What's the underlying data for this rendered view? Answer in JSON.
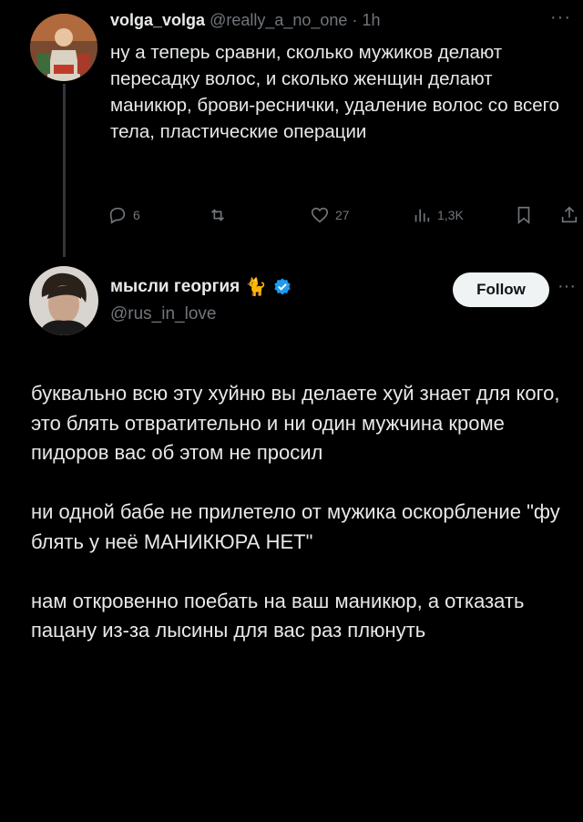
{
  "reply": {
    "name": "volga_volga",
    "handle": "@really_a_no_one",
    "separator": "·",
    "time": "1h",
    "more": "···",
    "text": "ну а теперь сравни, сколько мужиков делают пересадку волос, и сколько женщин делают маникюр, брови-реснички, удаление волос со всего тела, пластические операции",
    "actions": {
      "replies": "6",
      "reposts": "",
      "likes": "27",
      "views": "1,3K"
    }
  },
  "main": {
    "name": "мысли георгия",
    "name_emoji": "🐈",
    "handle": "@rus_in_love",
    "follow_label": "Follow",
    "more": "···",
    "paragraphs": [
      "буквально всю эту хуйню вы делаете хуй знает для кого, это блять отвратительно и ни один мужчина кроме пидоров вас об этом не просил",
      "ни одной бабе не прилетело от мужика оскорбление \"фу блять у неё МАНИКЮРА НЕТ\"",
      "нам откровенно поебать на ваш маникюр, а отказать пацану из-за лысины для вас раз плюнуть"
    ]
  },
  "colors": {
    "background": "#000000",
    "text": "#e7e9ea",
    "muted": "#71767b",
    "verified": "#1d9bf0",
    "follow_bg": "#eff3f4"
  }
}
